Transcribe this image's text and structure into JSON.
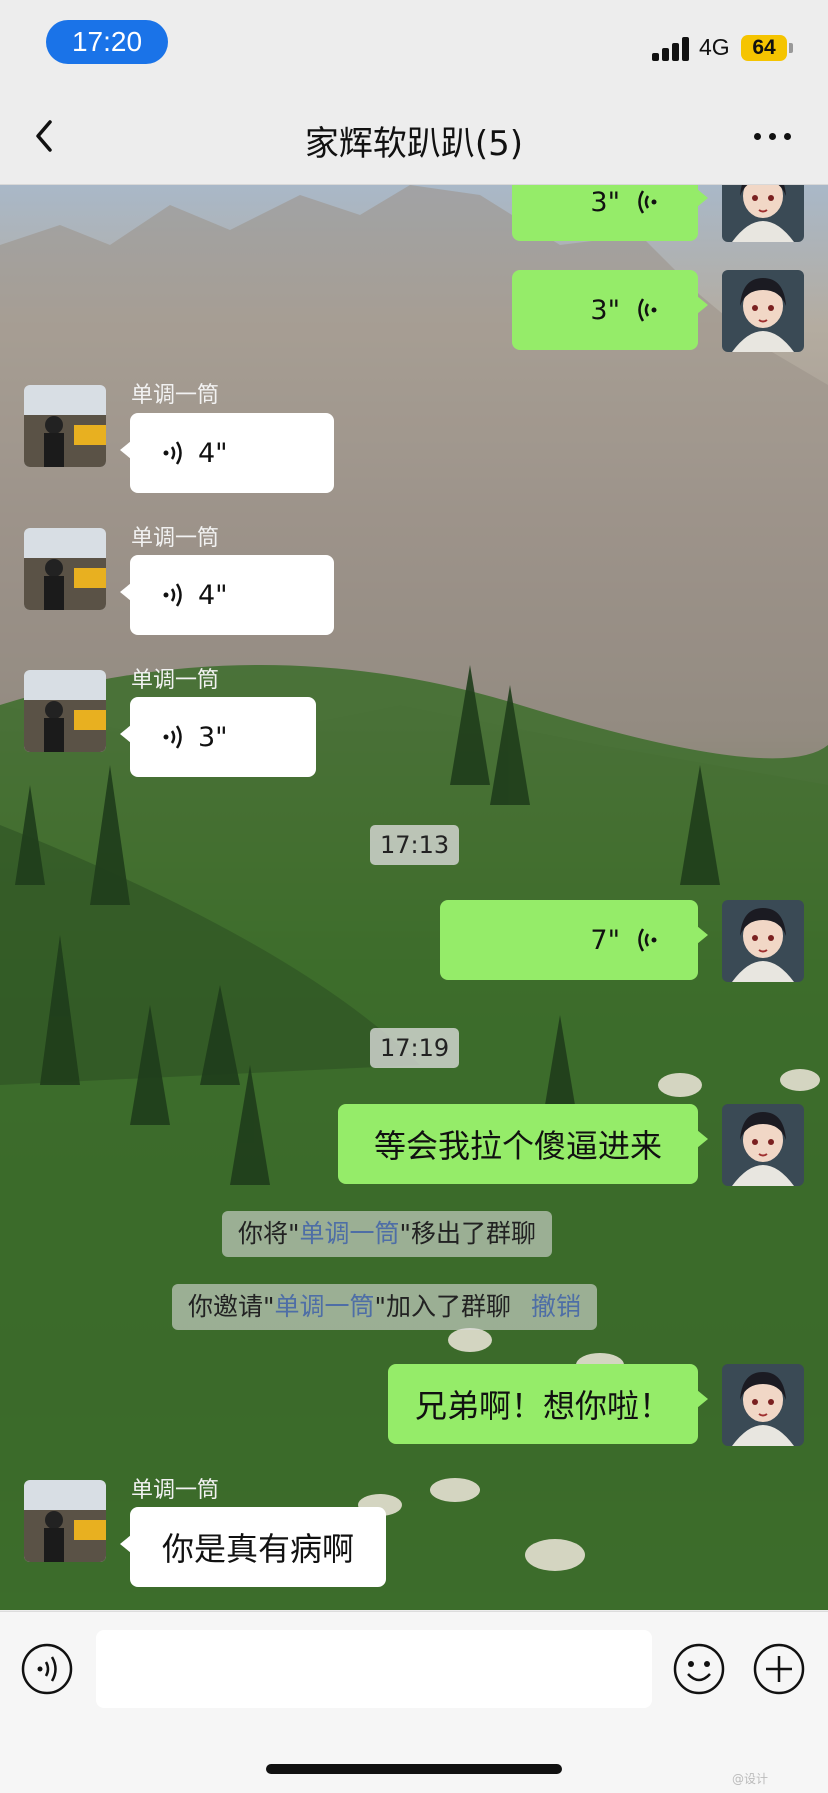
{
  "status_bar": {
    "time": "17:20",
    "network": "4G",
    "battery": "64"
  },
  "header": {
    "title": "家辉软趴趴(5)"
  },
  "messages": {
    "m1": {
      "duration": "3\""
    },
    "m2": {
      "duration": "3\""
    },
    "m3": {
      "sender": "单调一筒",
      "duration": "4\""
    },
    "m4": {
      "sender": "单调一筒",
      "duration": "4\""
    },
    "m5": {
      "sender": "单调一筒",
      "duration": "3\""
    },
    "ts1": "17:13",
    "m6": {
      "duration": "7\""
    },
    "ts2": "17:19",
    "m7": {
      "text": "等会我拉个傻逼进来"
    },
    "sys1": {
      "prefix": "你将\"",
      "name": "单调一筒",
      "suffix": "\"移出了群聊"
    },
    "sys2": {
      "prefix": "你邀请\"",
      "name": "单调一筒",
      "suffix": "\"加入了群聊",
      "action": "撤销"
    },
    "m8": {
      "text": "兄弟啊！想你啦！"
    },
    "m9": {
      "sender": "单调一筒",
      "text": "你是真有病啊"
    }
  },
  "input_bar": {
    "placeholder": ""
  },
  "watermark": "@设计"
}
